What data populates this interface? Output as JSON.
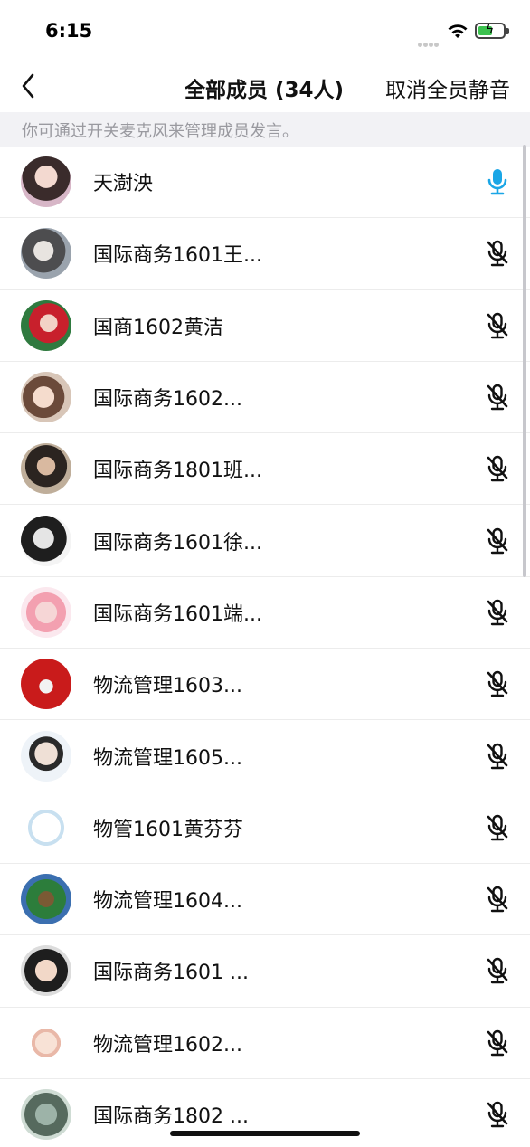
{
  "status_bar": {
    "time": "6:15"
  },
  "nav": {
    "title": "全部成员 (34人)",
    "action": "取消全员静音"
  },
  "hint": "你可通过开关麦克风来管理成员发言。",
  "colors": {
    "active_mic": "#1aa6e6",
    "muted_mic": "#111111",
    "hint_bg": "#f2f2f5"
  },
  "members": [
    {
      "name": "天澍泱",
      "mic": "on"
    },
    {
      "name": "国际商务1601王...",
      "mic": "muted"
    },
    {
      "name": "国商1602黄洁",
      "mic": "muted"
    },
    {
      "name": "国际商务1602...",
      "mic": "muted"
    },
    {
      "name": "国际商务1801班...",
      "mic": "muted"
    },
    {
      "name": "国际商务1601徐...",
      "mic": "muted"
    },
    {
      "name": "国际商务1601端...",
      "mic": "muted"
    },
    {
      "name": "物流管理1603...",
      "mic": "muted"
    },
    {
      "name": "物流管理1605...",
      "mic": "muted"
    },
    {
      "name": "物管1601黄芬芬",
      "mic": "muted"
    },
    {
      "name": "物流管理1604...",
      "mic": "muted"
    },
    {
      "name": "国际商务1601 ...",
      "mic": "muted"
    },
    {
      "name": "物流管理1602...",
      "mic": "muted"
    },
    {
      "name": "国际商务1802 ...",
      "mic": "muted"
    }
  ]
}
